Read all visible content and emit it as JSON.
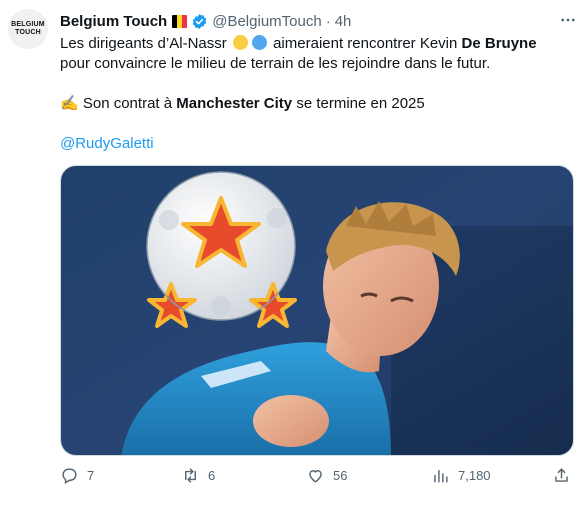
{
  "author": {
    "name": "Belgium Touch",
    "handle": "@BelgiumTouch",
    "separator": "·",
    "time": "4h",
    "avatar_text_1": "BELGIUM",
    "avatar_text_2": "TOUCH",
    "flag_colors": [
      "#000000",
      "#fdda24",
      "#ef3340"
    ],
    "verified_color": "#1d9bf0"
  },
  "menu_icon": "more-horizontal-icon",
  "tweet": {
    "line1_a": "Les dirigeants d’Al-Nassr",
    "line1_b": "aimeraient rencontrer Kevin",
    "line1_bold": "De Bruyne",
    "line2": "pour convaincre le milieu de terrain de les rejoindre dans le futur.",
    "line3_emoji": "✍️",
    "line3_a": "Son contrat à",
    "line3_bold": "Manchester City",
    "line3_b": "se termine en 2025",
    "mention": "@RudyGaletti",
    "emoji_colors": [
      "#f9cc43",
      "#52a8f0"
    ]
  },
  "actions": {
    "replies": "7",
    "retweets": "6",
    "likes": "56",
    "views": "7,180"
  },
  "colors": {
    "text": "#0f1419",
    "muted": "#536471",
    "link": "#1d9bf0",
    "jersey": "#1e8ac5"
  }
}
